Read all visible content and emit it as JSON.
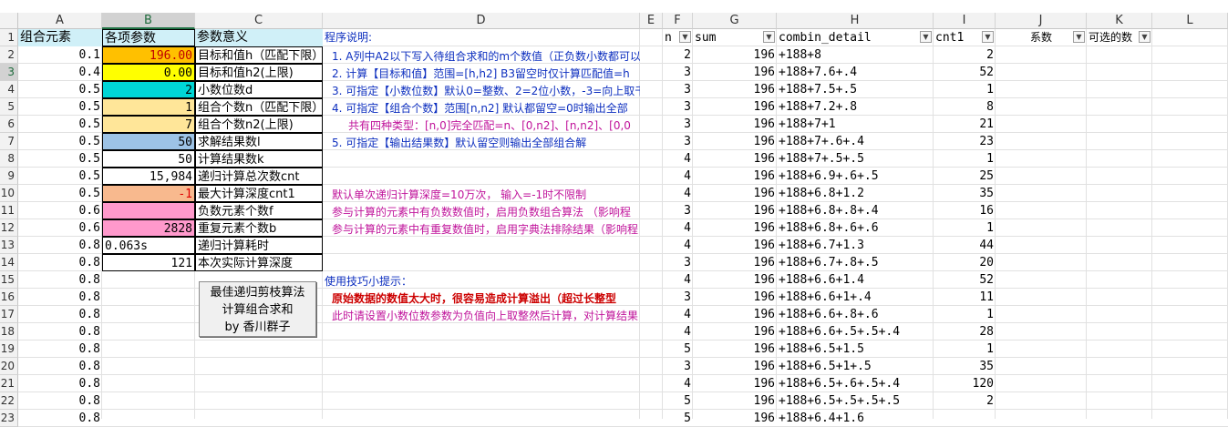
{
  "columns": [
    "A",
    "B",
    "C",
    "D",
    "E",
    "F",
    "G",
    "H",
    "I",
    "J",
    "K",
    "L"
  ],
  "rows": [
    "1",
    "2",
    "3",
    "4",
    "5",
    "6",
    "7",
    "8",
    "9",
    "10",
    "11",
    "12",
    "13",
    "14",
    "15",
    "16",
    "17",
    "18",
    "19",
    "20",
    "21",
    "22",
    "23"
  ],
  "header_row": {
    "a1": "组合元素",
    "b1": "各项参数",
    "c1": "参数意义",
    "d1": "程序说明:",
    "f1": "n",
    "g1": "sum",
    "h1": "combin_detail",
    "i1": "cnt1",
    "j1": "系数",
    "k1": "可选的数"
  },
  "col_a": [
    "0.1",
    "0.4",
    "0.5",
    "0.5",
    "0.5",
    "0.5",
    "0.5",
    "0.5",
    "0.5",
    "0.6",
    "0.6",
    "0.8",
    "0.8",
    "0.8",
    "0.8",
    "0.8",
    "0.8",
    "0.8",
    "0.8",
    "0.8",
    "0.8",
    "0.8"
  ],
  "col_b": [
    "196.00",
    "0.00",
    "2",
    "1",
    "7",
    "50",
    "50",
    "15,984",
    "-1",
    "",
    "2828",
    "0.063s",
    "121"
  ],
  "col_c": [
    "目标和值h（匹配下限）",
    "目标和值h2(上限)",
    "小数位数d",
    "组合个数n（匹配下限）",
    "组合个数n2(上限)",
    "求解结果数l",
    "计算结果数k",
    "递归计算总次数cnt",
    "最大计算深度cnt1",
    "负数元素个数f",
    "重复元素个数b",
    "递归计算耗时",
    "本次实际计算深度"
  ],
  "notes": {
    "n1": "1. A列中A2以下写入待组合求和的m个数值（正负数小数都可以",
    "n2": "2. 计算【目标和值】范围=[h,h2] B3留空时仅计算匹配值=h",
    "n3": "3. 可指定【小数位数】默认0=整数、2=2位小数，-3=向上取千",
    "n4": "4. 可指定【组合个数】范围[n,n2] 默认都留空=0时输出全部",
    "n5": "共有四种类型：[n,0]完全匹配=n、[0,n2]、[n,n2]、[0,0",
    "n6": "5. 可指定【输出结果数】默认留空则输出全部组合解",
    "n7": "默认单次递归计算深度=10万次， 输入=-1时不限制",
    "n8": "参与计算的元素中有负数数值时，启用负数组合算法  （影响程",
    "n9": "参与计算的元素中有重复数值时，启用字典法排除结果（影响程",
    "n10": "使用技巧小提示：",
    "n11": "原始数据的数值太大时，很容易造成计算溢出（超过长整型",
    "n12": "此时请设置小数位数参数为负值向上取整然后计算，对计算结果"
  },
  "results": {
    "n": [
      "2",
      "3",
      "3",
      "3",
      "3",
      "3",
      "4",
      "4",
      "4",
      "3",
      "4",
      "4",
      "3",
      "4",
      "3",
      "4",
      "4",
      "5",
      "3",
      "4",
      "5",
      "5",
      "3"
    ],
    "sum": [
      "196",
      "196",
      "196",
      "196",
      "196",
      "196",
      "196",
      "196",
      "196",
      "196",
      "196",
      "196",
      "196",
      "196",
      "196",
      "196",
      "196",
      "196",
      "196",
      "196",
      "196",
      "196",
      "196"
    ],
    "detail": [
      "+188+8",
      "+188+7.6+.4",
      "+188+7.5+.5",
      "+188+7.2+.8",
      "+188+7+1",
      "+188+7+.6+.4",
      "+188+7+.5+.5",
      "+188+6.9+.6+.5",
      "+188+6.8+1.2",
      "+188+6.8+.8+.4",
      "+188+6.8+.6+.6",
      "+188+6.7+1.3",
      "+188+6.7+.8+.5",
      "+188+6.6+1.4",
      "+188+6.6+1+.4",
      "+188+6.6+.8+.6",
      "+188+6.6+.5+.5+.4",
      "+188+6.5+1.5",
      "+188+6.5+1+.5",
      "+188+6.5+.6+.5+.4",
      "+188+6.5+.5+.5+.5",
      "+188+6.4+1.6",
      ""
    ],
    "cnt1": [
      "2",
      "52",
      "1",
      "8",
      "21",
      "23",
      "1",
      "25",
      "35",
      "16",
      "1",
      "44",
      "20",
      "52",
      "11",
      "1",
      "28",
      "1",
      "35",
      "120",
      "2",
      "",
      ""
    ]
  },
  "macro_button": {
    "line1": "最佳递归剪枝算法",
    "line2": "计算组合求和",
    "line3": "by 香川群子"
  },
  "fills": {
    "b2": "#ffc000",
    "b3": "#ffff00",
    "b4": "#00d6d6",
    "b5": "#ffe699",
    "b6": "#ffe699",
    "b7": "#9dc3e6",
    "b10": "#f8b98e",
    "b11": "#ff99cc",
    "b12": "#ff99cc",
    "row1_header": "#d0f0f8"
  },
  "colors": {
    "blue_text": "#0d2fbf",
    "magenta_text": "#c0149b",
    "red_text": "#cc0000"
  }
}
